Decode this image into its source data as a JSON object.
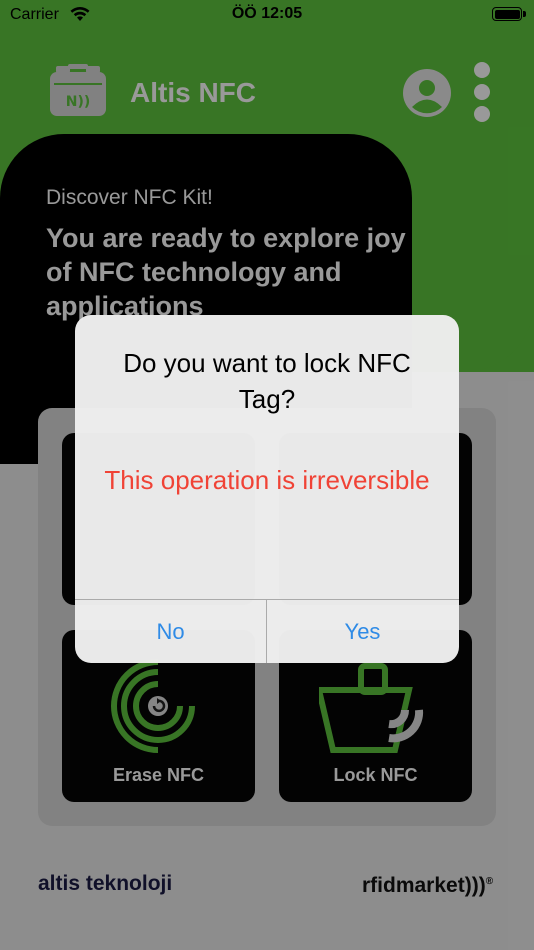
{
  "status_bar": {
    "carrier": "Carrier",
    "time": "ÖÖ 12:05"
  },
  "header": {
    "app_title": "Altis NFC"
  },
  "hero": {
    "subtitle": "Discover NFC Kit!",
    "title": "You are ready to explore joy of NFC technology and applications"
  },
  "tiles": [
    {
      "label": "Erase NFC",
      "icon": "erase-icon"
    },
    {
      "label": "Lock NFC",
      "icon": "lock-icon"
    }
  ],
  "footer": {
    "left_brand": "altis teknoloji",
    "right_brand": "rfidmarket"
  },
  "dialog": {
    "title": "Do you want to lock NFC Tag?",
    "message": "This operation is irreversible",
    "no_label": "No",
    "yes_label": "Yes"
  },
  "colors": {
    "brand_green": "#5ec43e",
    "alert_red": "#f04336",
    "button_blue": "#2f8be6"
  }
}
